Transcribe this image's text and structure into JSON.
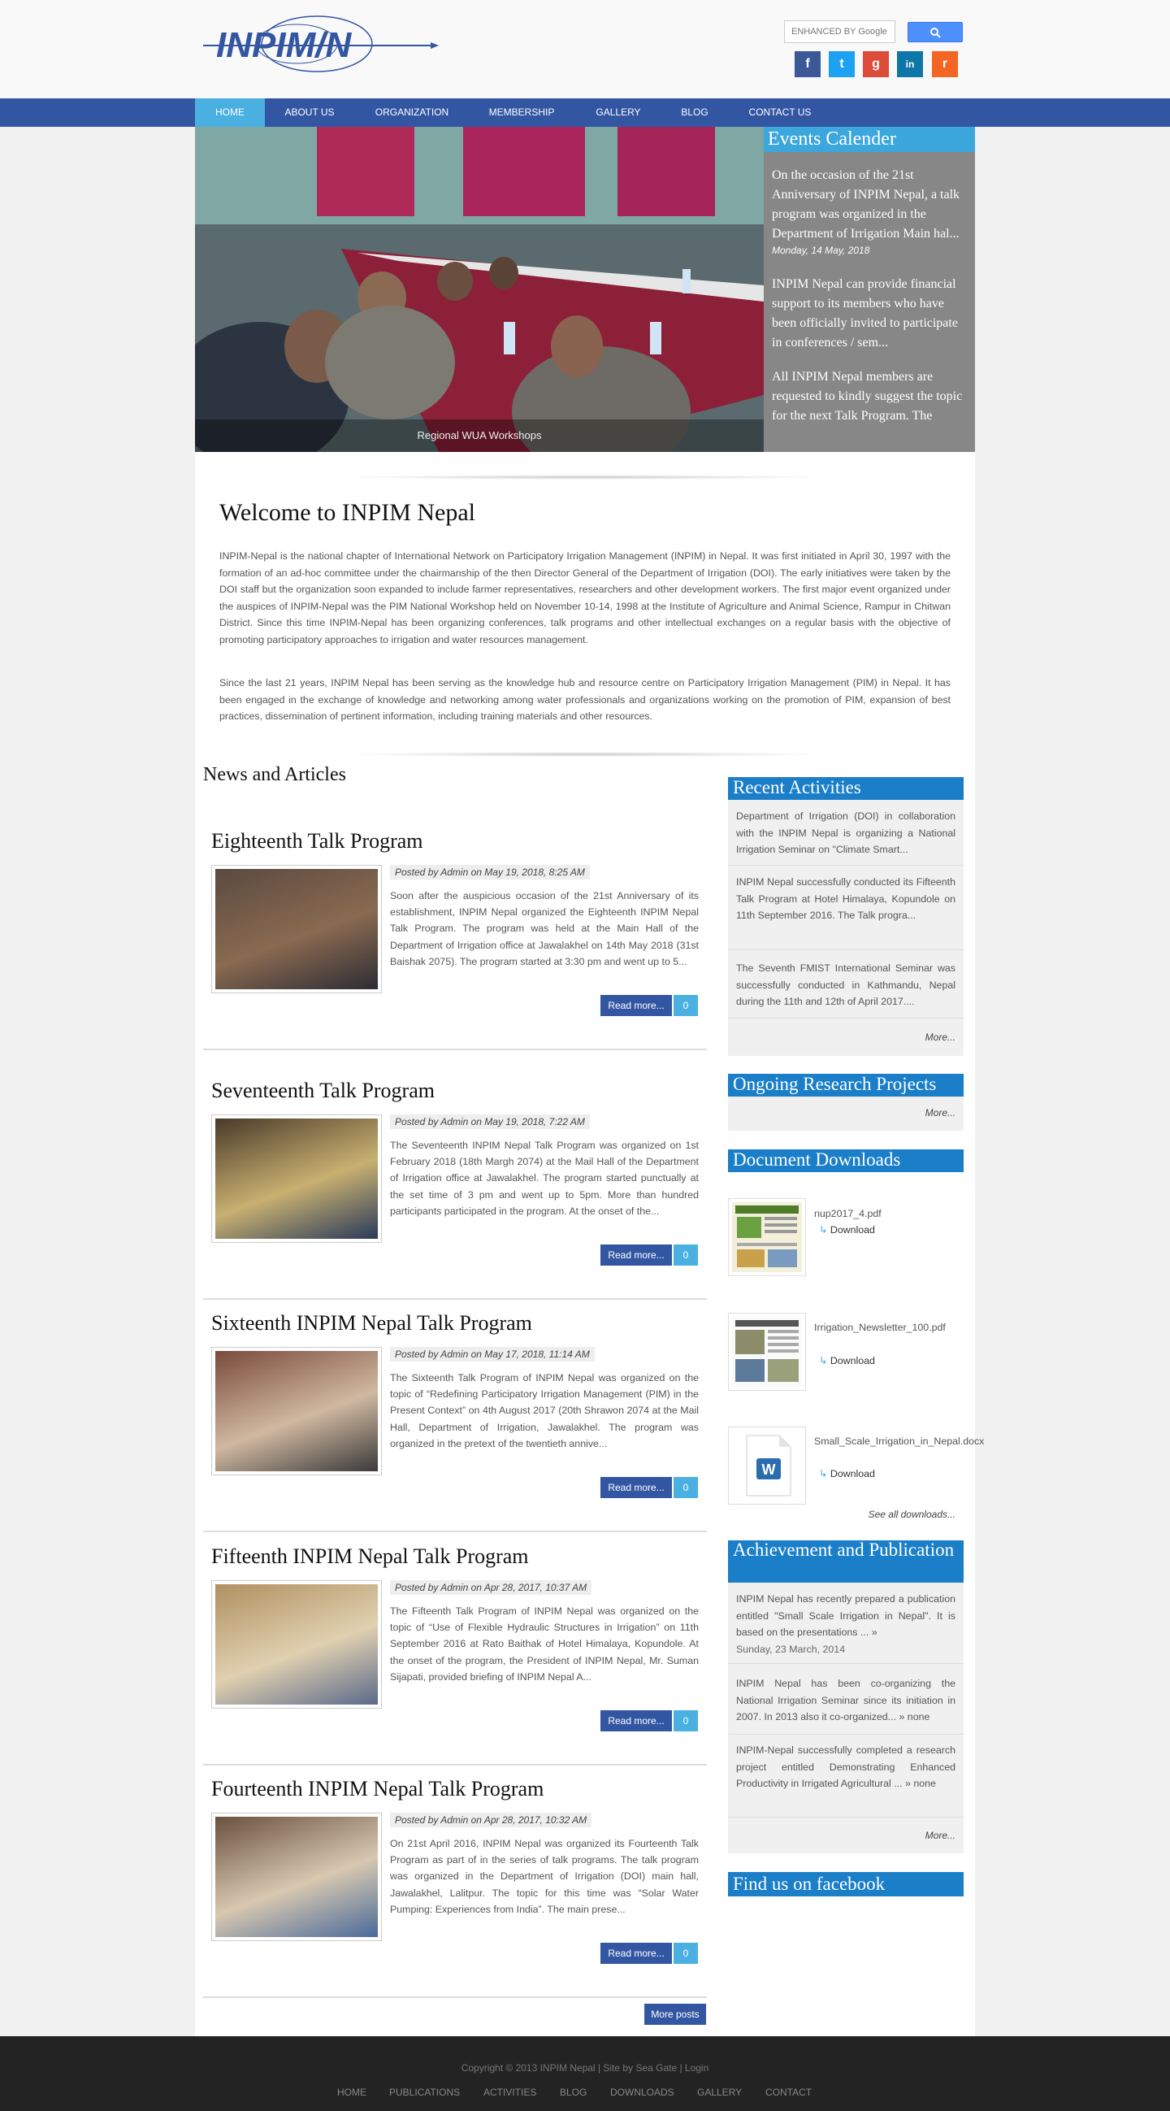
{
  "header": {
    "logo_text": "INPIM/N",
    "search_placeholder": "ENHANCED BY Google",
    "social": [
      {
        "icon": "facebook-icon",
        "glyph": "f",
        "color": "#3b5998"
      },
      {
        "icon": "twitter-icon",
        "glyph": "t",
        "color": "#1da1f2"
      },
      {
        "icon": "google-plus-icon",
        "glyph": "g",
        "color": "#dd4b39"
      },
      {
        "icon": "linkedin-icon",
        "glyph": "in",
        "color": "#0e76a8"
      },
      {
        "icon": "rss-icon",
        "glyph": "r",
        "color": "#f26522"
      }
    ]
  },
  "nav": [
    "HOME",
    "ABOUT US",
    "ORGANIZATION",
    "MEMBERSHIP",
    "GALLERY",
    "BLOG",
    "CONTACT US"
  ],
  "slider": {
    "caption": "Regional WUA Workshops"
  },
  "events": {
    "title": "Events Calender",
    "items": [
      {
        "text": "On the occasion of the 21st Anniversary of INPIM Nepal, a talk program was organized in the Department of Irrigation Main hal...",
        "date": "Monday, 14 May, 2018"
      },
      {
        "text": "INPIM Nepal can provide financial support to its members who have been officially invited to participate in conferences / sem...",
        "date": ""
      },
      {
        "text": "All INPIM Nepal members are requested to kindly suggest the topic for the next Talk Program. The",
        "date": ""
      }
    ]
  },
  "welcome": {
    "title": "Welcome to INPIM Nepal",
    "p1": "INPIM-Nepal is the national chapter of International Network on Participatory Irrigation Management (INPIM) in Nepal. It was first initiated in April 30, 1997 with the formation of an ad-hoc committee under the chairmanship of the then Director General of the Department of Irrigation (DOI). The early initiatives were taken by the DOI staff but the organization soon expanded to include farmer representatives, researchers and other development workers. The first major event organized under the auspices of INPIM-Nepal was the PIM National Workshop held on November 10-14, 1998 at the Institute of Agriculture and Animal Science, Rampur in Chitwan District. Since this time INPIM-Nepal has been organizing conferences, talk programs and other intellectual exchanges on a regular basis with the objective of promoting participatory approaches to irrigation and water resources management.",
    "p2": "Since the last 21 years, INPIM Nepal has been serving as the knowledge hub and resource centre on Participatory Irrigation Management (PIM) in Nepal. It has been engaged in the exchange of knowledge and networking among water professionals and organizations working on the promotion of PIM, expansion of best practices, dissemination of pertinent information, including training materials and other resources."
  },
  "news": {
    "title": "News and Articles",
    "read_more": "Read more...",
    "more_posts": "More posts",
    "posts": [
      {
        "title": "Eighteenth Talk Program",
        "meta": "Posted by Admin on May 19, 2018, 8:25 AM",
        "excerpt": "Soon after the auspicious occasion of the 21st Anniversary of its establishment, INPIM Nepal organized the Eighteenth INPIM Nepal Talk Program. The program was held at the Main Hall of the Department of Irrigation office at Jawalakhel on 14th May 2018 (31st Baishak 2075). The program started at 3:30 pm and went up to 5...",
        "comments": "0"
      },
      {
        "title": "Seventeenth Talk Program",
        "meta": "Posted by Admin on May 19, 2018, 7:22 AM",
        "excerpt": "The Seventeenth INPIM Nepal Talk Program was organized on 1st February 2018 (18th Margh 2074) at the Mail Hall of the Department of Irrigation office at Jawalakhel. The program started punctually at the set time of 3 pm and went up to 5pm. More than hundred participants participated in the program. At the onset of the...",
        "comments": "0"
      },
      {
        "title": "Sixteenth INPIM Nepal Talk Program",
        "meta": "Posted by Admin on May 17, 2018, 11:14 AM",
        "excerpt": "The Sixteenth Talk Program of INPIM Nepal was organized on the topic of “Redefining Participatory Irrigation Management (PIM) in the Present Context” on 4th August 2017 (20th Shrawon 2074 at the Mail Hall, Department of Irrigation, Jawalakhel. The program was organized in the pretext of the twentieth annive...",
        "comments": "0"
      },
      {
        "title": "Fifteenth INPIM Nepal Talk Program",
        "meta": "Posted by Admin on Apr 28, 2017, 10:37 AM",
        "excerpt": "The Fifteenth Talk Program of INPIM Nepal was organized on the topic of “Use of Flexible Hydraulic Structures in Irrigation” on 11th September 2016 at Rato Baithak of Hotel Himalaya, Kopundole. At the onset of the program, the President of INPIM Nepal, Mr. Suman Sijapati, provided briefing of INPIM Nepal A...",
        "comments": "0"
      },
      {
        "title": "Fourteenth INPIM Nepal Talk Program",
        "meta": "Posted by Admin on Apr 28, 2017, 10:32 AM",
        "excerpt": "On 21st April 2016, INPIM Nepal was organized its Fourteenth Talk Program as part of in the series of talk programs. The talk program was organized in the Department of Irrigation (DOI) main hall, Jawalakhel, Lalitpur. The topic for this time was “Solar Water Pumping: Experiences from India”. The main prese...",
        "comments": "0"
      }
    ]
  },
  "sidebar": {
    "recent": {
      "title": "Recent Activities",
      "items": [
        "Department of Irrigation (DOI) in collaboration with the INPIM Nepal is organizing a National Irrigation Seminar on \"Climate Smart...",
        "INPIM Nepal successfully conducted its Fifteenth Talk Program at Hotel Himalaya, Kopundole on 11th September 2016. The Talk progra...",
        "The Seventh FMIST International Seminar was successfully conducted in Kathmandu, Nepal during the 11th and 12th of April 2017...."
      ],
      "more": "More..."
    },
    "research": {
      "title": "Ongoing Research Projects",
      "more": "More..."
    },
    "downloads": {
      "title": "Document Downloads",
      "items": [
        {
          "name": "nup2017_4.pdf",
          "link": "Download"
        },
        {
          "name": "Irrigation_Newsletter_100.pdf",
          "link": "Download"
        },
        {
          "name": "Small_Scale_Irrigation_in_Nepal.docx",
          "link": "Download"
        }
      ],
      "all": "See all downloads..."
    },
    "achievement": {
      "title": "Achievement and Publication",
      "items": [
        {
          "text": "INPIM Nepal has recently prepared a publication entitled \"Small Scale Irrigation in Nepal\". It is based on the presentations ...",
          "tail": "»",
          "date": "Sunday, 23 March, 2014"
        },
        {
          "text": "INPIM Nepal has been co-organizing the National Irrigation Seminar since its initiation in 2007. In 2013 also it co-organized...",
          "tail": "» none",
          "date": ""
        },
        {
          "text": "INPIM-Nepal successfully completed a research project entitled Demonstrating Enhanced Productivity in Irrigated Agricultural ...",
          "tail": "» none",
          "date": ""
        }
      ],
      "more": "More..."
    },
    "facebook": {
      "title": "Find us on facebook"
    }
  },
  "footer": {
    "copyright": "Copyright © 2013 INPIM Nepal | Site by Sea Gate | Login",
    "links": [
      "HOME",
      "PUBLICATIONS",
      "ACTIVITIES",
      "BLOG",
      "DOWNLOADS",
      "GALLERY",
      "CONTACT"
    ]
  },
  "colors": {
    "nav": "#3356a3",
    "accent": "#4ab0e2",
    "sidebar_head": "#1a7ec8"
  }
}
